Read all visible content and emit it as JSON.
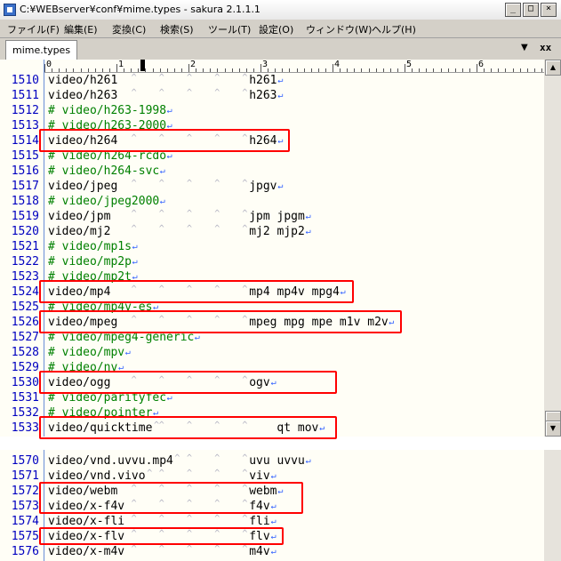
{
  "window": {
    "title": "C:¥WEBserver¥conf¥mime.types - sakura 2.1.1.1",
    "controls": {
      "minimize": "_",
      "maximize": "□",
      "close": "×"
    }
  },
  "menu": [
    "ファイル(F)",
    "編集(E)",
    "変換(C)",
    "検索(S)",
    "ツール(T)",
    "設定(O)",
    "ウィンドウ(W)",
    "ヘルプ(H)"
  ],
  "tabs": [
    {
      "label": "mime.types"
    }
  ],
  "tab_controls": {
    "dropdown": "▼",
    "close": "xx"
  },
  "ruler": [
    "0",
    "1",
    "2",
    "3",
    "4",
    "5",
    "6"
  ],
  "glyphs": {
    "tab": "^",
    "eol": "↵"
  },
  "lines_top": [
    {
      "n": "1510",
      "parts": [
        "video/h261",
        "h261"
      ]
    },
    {
      "n": "1511",
      "parts": [
        "video/h263",
        "h263"
      ]
    },
    {
      "n": "1512",
      "comment": "# video/h263-1998"
    },
    {
      "n": "1513",
      "comment": "# video/h263-2000"
    },
    {
      "n": "1514",
      "parts": [
        "video/h264",
        "h264"
      ]
    },
    {
      "n": "1515",
      "comment": "# video/h264-rcdo"
    },
    {
      "n": "1516",
      "comment": "# video/h264-svc"
    },
    {
      "n": "1517",
      "parts": [
        "video/jpeg",
        "jpgv"
      ]
    },
    {
      "n": "1518",
      "comment": "# video/jpeg2000"
    },
    {
      "n": "1519",
      "parts": [
        "video/jpm",
        "jpm jpgm"
      ]
    },
    {
      "n": "1520",
      "parts": [
        "video/mj2",
        "mj2 mjp2"
      ]
    },
    {
      "n": "1521",
      "comment": "# video/mp1s"
    },
    {
      "n": "1522",
      "comment": "# video/mp2p"
    },
    {
      "n": "1523",
      "comment": "# video/mp2t"
    },
    {
      "n": "1524",
      "parts": [
        "video/mp4",
        "mp4 mp4v mpg4"
      ]
    },
    {
      "n": "1525",
      "comment": "# video/mp4v-es"
    },
    {
      "n": "1526",
      "parts": [
        "video/mpeg",
        "mpeg mpg mpe m1v m2v"
      ]
    },
    {
      "n": "1527",
      "comment": "# video/mpeg4-generic"
    },
    {
      "n": "1528",
      "comment": "# video/mpv"
    },
    {
      "n": "1529",
      "comment": "# video/nv"
    },
    {
      "n": "1530",
      "parts": [
        "video/ogg",
        "ogv"
      ]
    },
    {
      "n": "1531",
      "comment": "# video/parityfec"
    },
    {
      "n": "1532",
      "comment": "# video/pointer"
    },
    {
      "n": "1533",
      "parts": [
        "video/quicktime",
        "qt mov"
      ]
    }
  ],
  "lines_bottom": [
    {
      "n": "1570",
      "parts": [
        "video/vnd.uvvu.mp4",
        "uvu uvvu"
      ]
    },
    {
      "n": "1571",
      "parts": [
        "video/vnd.vivo",
        "viv"
      ]
    },
    {
      "n": "1572",
      "parts": [
        "video/webm",
        "webm"
      ]
    },
    {
      "n": "1573",
      "parts": [
        "video/x-f4v",
        "f4v"
      ]
    },
    {
      "n": "1574",
      "parts": [
        "video/x-fli",
        "fli"
      ]
    },
    {
      "n": "1575",
      "parts": [
        "video/x-flv",
        "flv"
      ]
    },
    {
      "n": "1576",
      "parts": [
        "video/x-m4v",
        "m4v"
      ]
    }
  ],
  "highlight_color": "#ff0000",
  "text_colors": {
    "line_number": "#0000c0",
    "comment": "#008000",
    "eol": "#3060ff",
    "tab_mark": "#b0b0c0"
  }
}
